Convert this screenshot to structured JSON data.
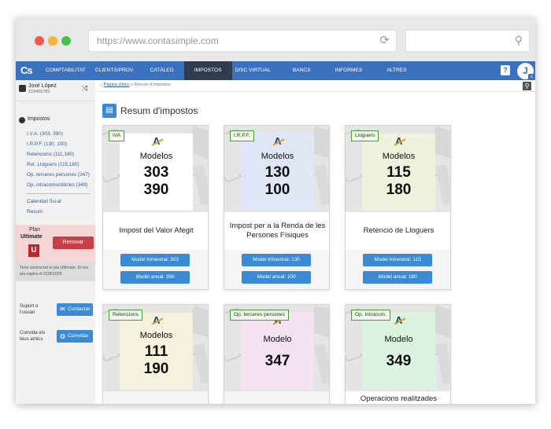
{
  "browser": {
    "url": "https://www.contasimple.com"
  },
  "nav": {
    "logo": "Cs",
    "items": [
      "Comptabilitat",
      "Clients/Prov.",
      "Catàleg",
      "Impostos",
      "Disc virtual",
      "Bancs",
      "Informes",
      "Altres"
    ],
    "active": "Impostos",
    "help": "?",
    "avatar_initial": "J"
  },
  "user": {
    "name": "José López",
    "id": "123456782"
  },
  "sidebar": {
    "section_title": "Impostos",
    "links": [
      "I.V.A. (303, 390)",
      "I.R.P.F. (130, 100)",
      "Retencions (111,190)",
      "Ret. Lloguers (115,180)",
      "Op. terceres persones (347)",
      "Op. intracomunitàries (349)"
    ],
    "links2": [
      "Calendari fiscal",
      "Resum"
    ],
    "plan_label": "Plan",
    "plan_name": "Ultimate",
    "plan_badge": "U",
    "renew_label": "Renovar",
    "plan_note": "Tens contractat el pla Ultimate. El teu pla expira el 21/8/2025.",
    "support_label": "Suport a l'usuari",
    "contact_label": "Contactar",
    "invite_text": "Convida els teus amics",
    "invite_label": "Convidar"
  },
  "breadcrumb": {
    "prefix": "::",
    "home": "Pàgina d'inici",
    "sep": ">",
    "current": "Resum d'impostos"
  },
  "page": {
    "title": "Resum d'impostos"
  },
  "cards": [
    {
      "tag": "IVA",
      "heading": "Modelos",
      "num1": "303",
      "num2": "390",
      "desc": "Impost del Valor Afegit",
      "btn1": "Model trimestral: 303",
      "btn2": "Model anual: 390",
      "color": "#ffffff"
    },
    {
      "tag": "I.R.P.F.",
      "heading": "Modelos",
      "num1": "130",
      "num2": "100",
      "desc": "Impost per a la Renda de les Persones Físiques",
      "btn1": "Model trimestral: 130",
      "btn2": "Model anual: 100",
      "color": "#dfe6f6"
    },
    {
      "tag": "Lloguers",
      "heading": "Modelos",
      "num1": "115",
      "num2": "180",
      "desc": "Retenció de Lloguers",
      "btn1": "Model trimestral: 115",
      "btn2": "Model anual: 180",
      "color": "#eff2dd"
    },
    {
      "tag": "Retencions",
      "heading": "Modelos",
      "num1": "111",
      "num2": "190",
      "desc": "",
      "color": "#f4f1dc"
    },
    {
      "tag": "Op. terceres persones",
      "heading": "Modelo",
      "num1": "347",
      "num2": "",
      "desc": "",
      "color": "#f5e2f3"
    },
    {
      "tag": "Op. Intracom.",
      "heading": "Modelo",
      "num1": "349",
      "num2": "",
      "desc": "Operacions realitzades",
      "color": "#dcf3e0"
    }
  ]
}
